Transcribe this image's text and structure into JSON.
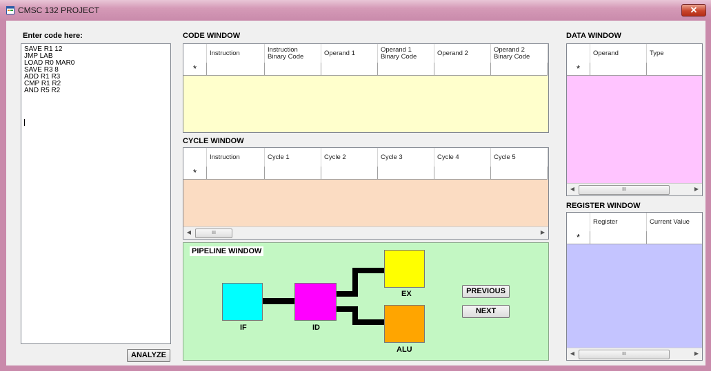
{
  "window": {
    "title": "CMSC 132 PROJECT",
    "close_glyph": "✕",
    "title_icon": "app-form-icon",
    "frame_color": "#c98aab"
  },
  "code_entry": {
    "label": "Enter code here:",
    "lines": [
      "SAVE R1 12",
      "JMP LAB",
      "LOAD R0 MAR0",
      "SAVE R3 8",
      "ADD R1 R3",
      "CMP R1 R2",
      "AND R5 R2"
    ],
    "analyze_label": "ANALYZE"
  },
  "code_window": {
    "title": "CODE WINDOW",
    "columns": [
      {
        "label": "Instruction",
        "w": 84
      },
      {
        "label": "Instruction Binary Code",
        "w": 82
      },
      {
        "label": "Operand 1",
        "w": 82
      },
      {
        "label": "Operand 1 Binary Code",
        "w": 82
      },
      {
        "label": "Operand 2",
        "w": 82
      },
      {
        "label": "Operand 2 Binary Code",
        "w": 82
      }
    ],
    "new_row_marker": "*",
    "fill_color": "#ffffcc"
  },
  "cycle_window": {
    "title": "CYCLE WINDOW",
    "columns": [
      {
        "label": "Instruction",
        "w": 84
      },
      {
        "label": "Cycle 1",
        "w": 82
      },
      {
        "label": "Cycle 2",
        "w": 82
      },
      {
        "label": "Cycle 3",
        "w": 82
      },
      {
        "label": "Cycle 4",
        "w": 82
      },
      {
        "label": "Cycle 5",
        "w": 82
      }
    ],
    "new_row_marker": "*",
    "fill_color": "#fbdcc2",
    "scroll_thumb": "III"
  },
  "pipeline_window": {
    "title": "PIPELINE WINDOW",
    "stages": {
      "if": {
        "label": "IF",
        "color": "#00ffff"
      },
      "id": {
        "label": "ID",
        "color": "#ff00ff"
      },
      "ex": {
        "label": "EX",
        "color": "#ffff00"
      },
      "alu": {
        "label": "ALU",
        "color": "#ffa500"
      }
    },
    "previous_label": "PREVIOUS",
    "next_label": "NEXT",
    "bg_color": "#c3f7c3"
  },
  "data_window": {
    "title": "DATA WINDOW",
    "columns": [
      {
        "label": "Operand",
        "w": 82
      },
      {
        "label": "Type",
        "w": 82
      }
    ],
    "new_row_marker": "*",
    "fill_color": "#ffc4ff",
    "scroll_thumb": "III"
  },
  "register_window": {
    "title": "REGISTER WINDOW",
    "columns": [
      {
        "label": "Register",
        "w": 82
      },
      {
        "label": "Current Value",
        "w": 82
      }
    ],
    "new_row_marker": "*",
    "fill_color": "#c4c4ff",
    "scroll_thumb": "III"
  }
}
